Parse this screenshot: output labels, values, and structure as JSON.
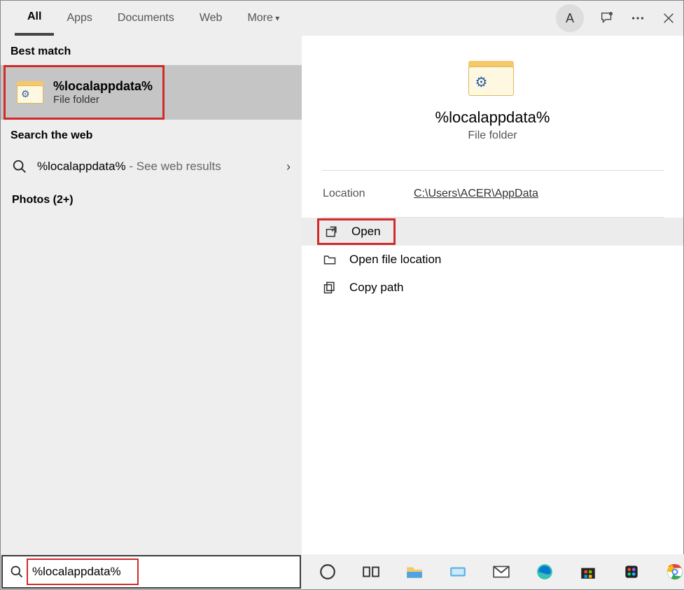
{
  "tabs": {
    "all": "All",
    "apps": "Apps",
    "documents": "Documents",
    "web": "Web",
    "more": "More"
  },
  "avatar_letter": "A",
  "left": {
    "best_match_label": "Best match",
    "best_match": {
      "title": "%localappdata%",
      "subtitle": "File folder"
    },
    "search_web_label": "Search the web",
    "web_result": {
      "query": "%localappdata%",
      "suffix": " - See web results"
    },
    "photos_label": "Photos (2+)"
  },
  "right": {
    "title": "%localappdata%",
    "subtitle": "File folder",
    "location_label": "Location",
    "location_value": "C:\\Users\\ACER\\AppData",
    "actions": {
      "open": "Open",
      "open_location": "Open file location",
      "copy_path": "Copy path"
    }
  },
  "search_input_value": "%localappdata%"
}
